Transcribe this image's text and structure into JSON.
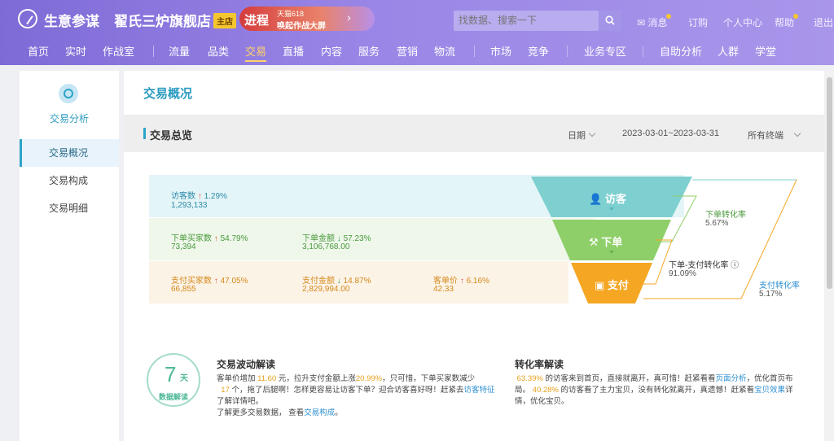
{
  "header": {
    "brand": "生意参谋",
    "shop": "翟氏三炉旗舰店",
    "shop_badge": "主店",
    "promo": {
      "big": "进程",
      "line1": "天猫618",
      "line2": "唤起作战大屏",
      "arrow": "›"
    },
    "search_placeholder": "找数据、搜索一下",
    "top_links": [
      "消息",
      "订购",
      "个人中心",
      "帮助",
      "退出"
    ]
  },
  "menu": {
    "items": [
      "首页",
      "实时",
      "作战室",
      "流量",
      "品类",
      "交易",
      "直播",
      "内容",
      "服务",
      "营销",
      "物流",
      "市场",
      "竞争",
      "业务专区",
      "自助分析",
      "人群",
      "学堂"
    ],
    "active": "交易"
  },
  "sidebar": {
    "title": "交易分析",
    "items": [
      "交易概况",
      "交易构成",
      "交易明细"
    ],
    "active": "交易概况"
  },
  "main": {
    "page_title": "交易概况",
    "section": {
      "title": "交易总览",
      "date_label": "日期",
      "date_range": "2023-03-01~2023-03-31",
      "terminal": "所有终端"
    },
    "metrics": {
      "visitors": {
        "label": "访客数",
        "arrow": "↑",
        "pct": "1.29%",
        "value": "1,293,133"
      },
      "order_buyers": {
        "label": "下单买家数",
        "arrow": "↑",
        "pct": "54.79%",
        "value": "73,394"
      },
      "order_amount": {
        "label": "下单金额",
        "arrow": "↓",
        "pct": "57.23%",
        "value": "3,106,768.00"
      },
      "pay_buyers": {
        "label": "支付买家数",
        "arrow": "↑",
        "pct": "47.05%",
        "value": "66,855"
      },
      "pay_amount": {
        "label": "支付金额",
        "arrow": "↓",
        "pct": "14.87%",
        "value": "2,829,994.00"
      },
      "unit_price": {
        "label": "客单价",
        "arrow": "↑",
        "pct": "6.16%",
        "value": "42.33"
      }
    },
    "funnel": {
      "stages": [
        "访客",
        "下单",
        "支付"
      ],
      "colors": [
        "#7ecfd0",
        "#8fcf6a",
        "#f5a623"
      ],
      "rates": [
        {
          "title": "下单转化率",
          "value": "5.67%"
        },
        {
          "title": "下单-支付转化率",
          "value": "91.09%"
        },
        {
          "title": "支付转化率",
          "value": "5.17%"
        }
      ]
    },
    "seven_days": {
      "num": "7",
      "unit": "天",
      "sub": "数据解读"
    },
    "fluctuation": {
      "title": "交易波动解读",
      "l1a": "客单价增加",
      "l1b": "11.60",
      "l1c": "元，拉升支付金额上涨",
      "l1d": "20.99%",
      "l1e": "，只可惜，下单买家数减少",
      "l2a": "17",
      "l2b": "个，拖了后腿啊！怎样更容易让访客下单？迎合访客喜好呀！赶紧去",
      "l2c": "访客特征",
      "l3": "了解详情吧。",
      "l4a": "了解更多交易数据，  查看",
      "l4b": "交易构成",
      "l4c": "。"
    },
    "conversion": {
      "title": "转化率解读",
      "l1a": "63.39%",
      "l1b": "的访客来到首页，直接就离开，真可惜！赶紧看看",
      "l1c": "页面分析",
      "l1d": "，优化首页布",
      "l2a": "局。",
      "l2b": "40.28%",
      "l2c": "的访客看了主力宝贝，没有转化就离开，真遗憾！赶紧看",
      "l2d": "宝贝效果",
      "l2e": "详",
      "l3": "情，优化宝贝。"
    }
  }
}
